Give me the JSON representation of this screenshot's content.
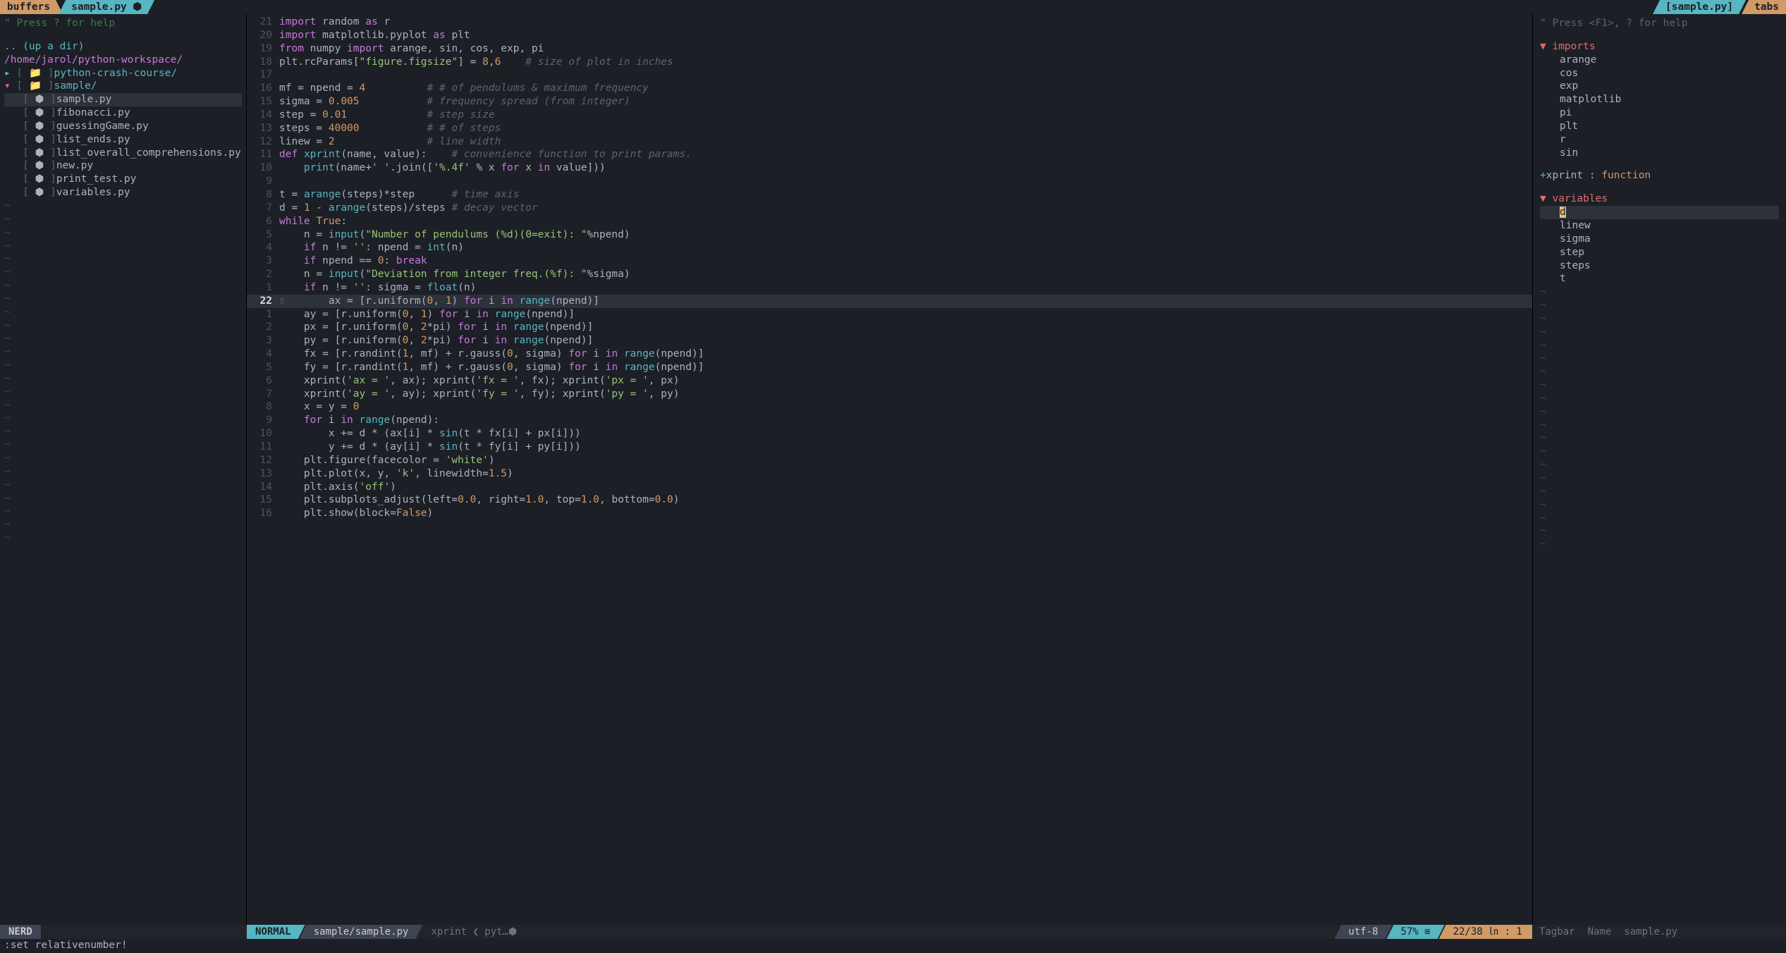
{
  "tabline": {
    "buffers_label": "buffers",
    "active_buffer": "sample.py ⬢",
    "tabs_label": "tabs",
    "right_buffer": "[sample.py]"
  },
  "nerdtree": {
    "help": "\" Press ? for help",
    "updir": ".. (up a dir)",
    "root": "/home/jarol/python-workspace/",
    "dirs": [
      {
        "name": "python-crash-course/",
        "open": false
      },
      {
        "name": "sample/",
        "open": true
      }
    ],
    "files_in_sample": [
      {
        "name": "sample.py",
        "selected": true
      },
      {
        "name": "fibonacci.py"
      },
      {
        "name": "guessingGame.py"
      },
      {
        "name": "list_ends.py"
      },
      {
        "name": "list_overall_comprehensions.py"
      },
      {
        "name": "new.py"
      },
      {
        "name": "print_test.py"
      },
      {
        "name": "variables.py"
      }
    ]
  },
  "editor": {
    "current_abs_line": 22,
    "lines": [
      {
        "rel": 21,
        "html": "<span class='k'>import</span> <span class='id'>random</span> <span class='k'>as</span> <span class='id'>r</span>"
      },
      {
        "rel": 20,
        "html": "<span class='k'>import</span> <span class='id'>matplotlib.pyplot</span> <span class='k'>as</span> <span class='id'>plt</span>"
      },
      {
        "rel": 19,
        "html": "<span class='k'>from</span> <span class='id'>numpy</span> <span class='k'>import</span> <span class='id'>arange, sin, cos, exp, pi</span>"
      },
      {
        "rel": 18,
        "html": "<span class='id'>plt.rcParams[</span><span class='s'>\"figure.figsize\"</span><span class='id'>]</span> = <span class='n'>8</span>,<span class='n'>6</span>    <span class='c'># size of plot in inches</span>"
      },
      {
        "rel": 17,
        "html": ""
      },
      {
        "rel": 16,
        "html": "<span class='id'>mf</span> = <span class='id'>npend</span> = <span class='n'>4</span>          <span class='c'># # of pendulums &amp; maximum frequency</span>"
      },
      {
        "rel": 15,
        "html": "<span class='id'>sigma</span> = <span class='n'>0.005</span>           <span class='c'># frequency spread (from integer)</span>"
      },
      {
        "rel": 14,
        "html": "<span class='id'>step</span> = <span class='n'>0.01</span>             <span class='c'># step size</span>"
      },
      {
        "rel": 13,
        "html": "<span class='id'>steps</span> = <span class='n'>40000</span>           <span class='c'># # of steps</span>"
      },
      {
        "rel": 12,
        "html": "<span class='id'>linew</span> = <span class='n'>2</span>               <span class='c'># line width</span>"
      },
      {
        "rel": 11,
        "html": "<span class='k'>def</span> <span class='f'>xprint</span>(name, value):    <span class='c'># convenience function to print params.</span>"
      },
      {
        "rel": 10,
        "html": "    <span class='f'>print</span>(name+<span class='s'>' '</span>.join([<span class='s'>'%.4f'</span> % x <span class='k'>for</span> x <span class='k'>in</span> value]))"
      },
      {
        "rel": 9,
        "html": ""
      },
      {
        "rel": 8,
        "html": "<span class='id'>t</span> = <span class='f'>arange</span>(steps)*step      <span class='c'># time axis</span>"
      },
      {
        "rel": 7,
        "html": "<span class='id'>d</span> = <span class='n'>1</span> - <span class='f'>arange</span>(steps)/steps <span class='c'># decay vector</span>"
      },
      {
        "rel": 6,
        "html": "<span class='k'>while</span> <span class='n'>True</span>:"
      },
      {
        "rel": 5,
        "html": "    n = <span class='f'>input</span>(<span class='s'>\"Number of pendulums (%d)(0=exit): \"</span>%npend)"
      },
      {
        "rel": 4,
        "html": "    <span class='k'>if</span> n != <span class='s'>''</span>: npend = <span class='f'>int</span>(n)"
      },
      {
        "rel": 3,
        "html": "    <span class='k'>if</span> npend == <span class='n'>0</span>: <span class='k'>break</span>"
      },
      {
        "rel": 2,
        "html": "    n = <span class='f'>input</span>(<span class='s'>\"Deviation from integer freq.(%f): \"</span>%sigma)"
      },
      {
        "rel": 1,
        "html": "    <span class='k'>if</span> n != <span class='s'>''</span>: sigma = <span class='f'>float</span>(n)"
      },
      {
        "rel": 0,
        "cur": true,
        "html": "    ax = [r.uniform(<span class='n'>0</span>, <span class='n'>1</span>) <span class='k'>for</span> i <span class='k'>in</span> <span class='f'>range</span>(npend)]"
      },
      {
        "rel": 1,
        "html": "    ay = [r.uniform(<span class='n'>0</span>, <span class='n'>1</span>) <span class='k'>for</span> i <span class='k'>in</span> <span class='f'>range</span>(npend)]"
      },
      {
        "rel": 2,
        "html": "    px = [r.uniform(<span class='n'>0</span>, <span class='n'>2</span>*pi) <span class='k'>for</span> i <span class='k'>in</span> <span class='f'>range</span>(npend)]"
      },
      {
        "rel": 3,
        "html": "    py = [r.uniform(<span class='n'>0</span>, <span class='n'>2</span>*pi) <span class='k'>for</span> i <span class='k'>in</span> <span class='f'>range</span>(npend)]"
      },
      {
        "rel": 4,
        "html": "    fx = [r.randint(<span class='n'>1</span>, mf) + r.gauss(<span class='n'>0</span>, sigma) <span class='k'>for</span> i <span class='k'>in</span> <span class='f'>range</span>(npend)]"
      },
      {
        "rel": 5,
        "html": "    fy = [r.randint(<span class='n'>1</span>, mf) + r.gauss(<span class='n'>0</span>, sigma) <span class='k'>for</span> i <span class='k'>in</span> <span class='f'>range</span>(npend)]"
      },
      {
        "rel": 6,
        "html": "    xprint(<span class='s'>'ax = '</span>, ax); xprint(<span class='s'>'fx = '</span>, fx); xprint(<span class='s'>'px = '</span>, px)"
      },
      {
        "rel": 7,
        "html": "    xprint(<span class='s'>'ay = '</span>, ay); xprint(<span class='s'>'fy = '</span>, fy); xprint(<span class='s'>'py = '</span>, py)"
      },
      {
        "rel": 8,
        "html": "    x = y = <span class='n'>0</span>"
      },
      {
        "rel": 9,
        "html": "    <span class='k'>for</span> i <span class='k'>in</span> <span class='f'>range</span>(npend):"
      },
      {
        "rel": 10,
        "html": "        x += d * (ax[i] * <span class='f'>sin</span>(t * fx[i] + px[i]))"
      },
      {
        "rel": 11,
        "html": "        y += d * (ay[i] * <span class='f'>sin</span>(t * fy[i] + py[i]))"
      },
      {
        "rel": 12,
        "html": "    plt.figure(facecolor = <span class='s'>'white'</span>)"
      },
      {
        "rel": 13,
        "html": "    plt.plot(x, y, <span class='s'>'k'</span>, linewidth=<span class='n'>1.5</span>)"
      },
      {
        "rel": 14,
        "html": "    plt.axis(<span class='s'>'off'</span>)"
      },
      {
        "rel": 15,
        "html": "    plt.subplots_adjust(left=<span class='n'>0.0</span>, right=<span class='n'>1.0</span>, top=<span class='n'>1.0</span>, bottom=<span class='n'>0.0</span>)"
      },
      {
        "rel": 16,
        "html": "    plt.show(block=<span class='n'>False</span>)"
      }
    ]
  },
  "tagbar": {
    "help": "\" Press <F1>, ? for help",
    "sections": [
      {
        "title": "imports",
        "items": [
          "arange",
          "cos",
          "exp",
          "matplotlib",
          "pi",
          "plt",
          "r",
          "sin"
        ]
      }
    ],
    "func": {
      "name": "xprint",
      "kind": "function"
    },
    "vars_title": "variables",
    "vars": [
      {
        "name": "d",
        "selected": true
      },
      {
        "name": "linew"
      },
      {
        "name": "sigma"
      },
      {
        "name": "step"
      },
      {
        "name": "steps"
      },
      {
        "name": "t"
      }
    ]
  },
  "status": {
    "left": "NERD",
    "mode": "NORMAL",
    "path": "sample/sample.py",
    "context": "xprint ❮ pyt…⬢",
    "encoding": "utf-8 ",
    "percent": "57% ≡",
    "position": "22/38 ㏑ :  1 ",
    "tagbar": {
      "a": "Tagbar",
      "b": "Name",
      "c": "sample.py"
    }
  },
  "cmdline": ":set relativenumber!"
}
